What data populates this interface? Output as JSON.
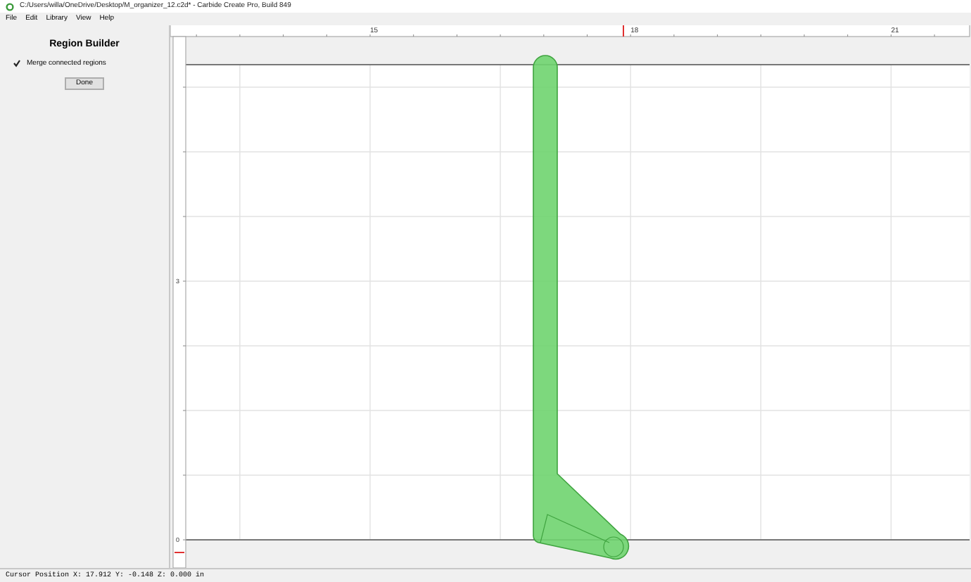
{
  "window": {
    "title": "C:/Users/willa/OneDrive/Desktop/M_organizer_12.c2d* - Carbide Create Pro, Build 849"
  },
  "menu": [
    {
      "label": "File"
    },
    {
      "label": "Edit"
    },
    {
      "label": "Library"
    },
    {
      "label": "View"
    },
    {
      "label": "Help"
    }
  ],
  "panel": {
    "title": "Region Builder",
    "checkbox": {
      "label": "Merge connected regions",
      "checked": true
    },
    "button": "Done"
  },
  "rulers": {
    "x_labels": [
      "15",
      "18",
      "21"
    ],
    "y_labels": [
      "3",
      "0"
    ]
  },
  "status_bar": {
    "text": "Cursor Position X: 17.912 Y: -0.148 Z: 0.000 in"
  }
}
